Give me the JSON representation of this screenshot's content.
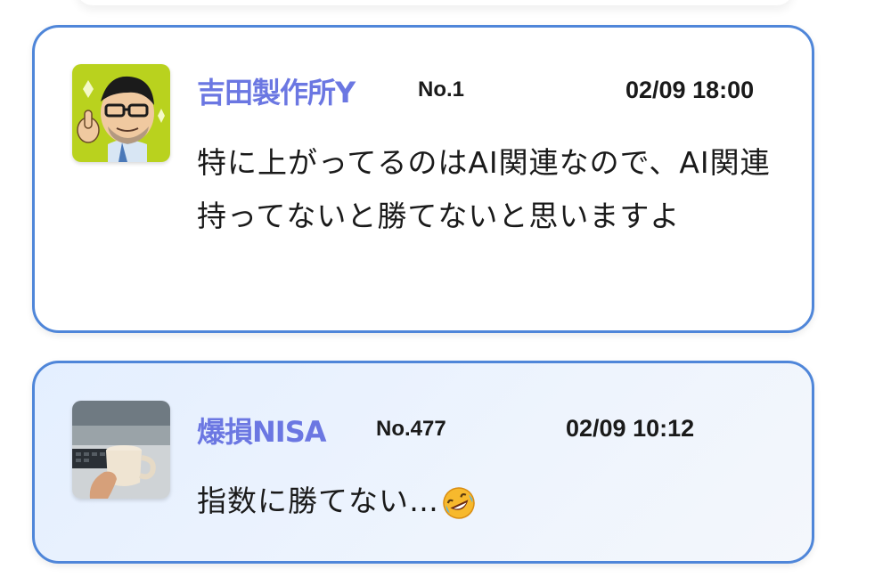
{
  "posts": [
    {
      "author": "吉田製作所Y",
      "number": "No.1",
      "timestamp": "02/09 18:00",
      "body": "特に上がってるのはAI関連なので、AI関連持ってないと勝てないと思いますよ"
    },
    {
      "author": "爆損NISA",
      "number": "No.477",
      "timestamp": "02/09 10:12",
      "body": "指数に勝てない…",
      "emoji": "rolling-on-floor-laughing-emoji"
    }
  ],
  "colors": {
    "card_border": "#4f86d9",
    "author_name": "#6b77e2",
    "highlight_card_bg": "#e8f1ff"
  }
}
